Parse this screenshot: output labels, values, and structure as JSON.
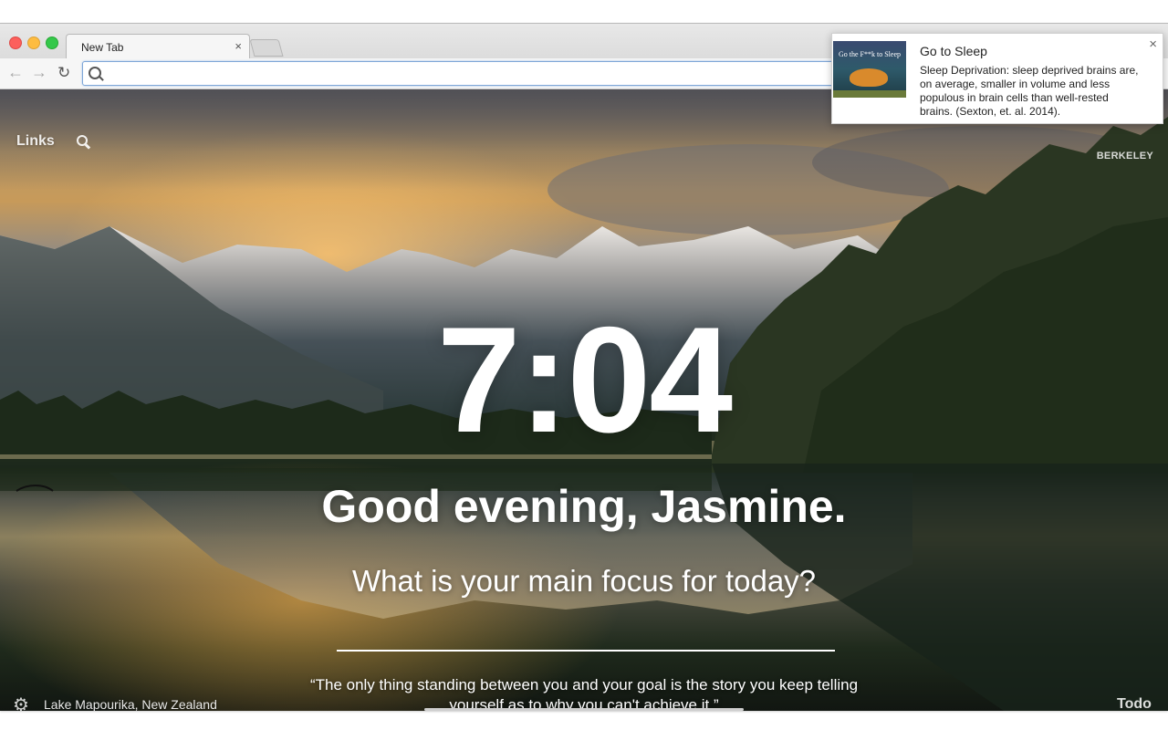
{
  "browser": {
    "tab_title": "New Tab",
    "tab_close": "×",
    "omnibox_value": "",
    "back_icon": "←",
    "forward_icon": "→",
    "reload_icon": "↻"
  },
  "header": {
    "links_label": "Links",
    "photo_credit": "BERKELEY"
  },
  "main": {
    "time": "7:04",
    "greeting": "Good evening, Jasmine.",
    "focus_question": "What is your main focus for today?",
    "focus_value": ""
  },
  "footer": {
    "location": "Lake Mapourika, New Zealand",
    "quote": "“The only thing standing between you and your goal is the story you keep telling yourself as to why you can't achieve it.”",
    "todo_label": "Todo",
    "settings_icon": "⚙"
  },
  "notification": {
    "title": "Go to Sleep",
    "body": "Sleep Deprivation: sleep deprived brains are, on average, smaller in volume and less populous in brain cells than well-rested brains. (Sexton, et. al. 2014).",
    "close": "×",
    "thumbnail_title": "Go the F**k to Sleep"
  }
}
